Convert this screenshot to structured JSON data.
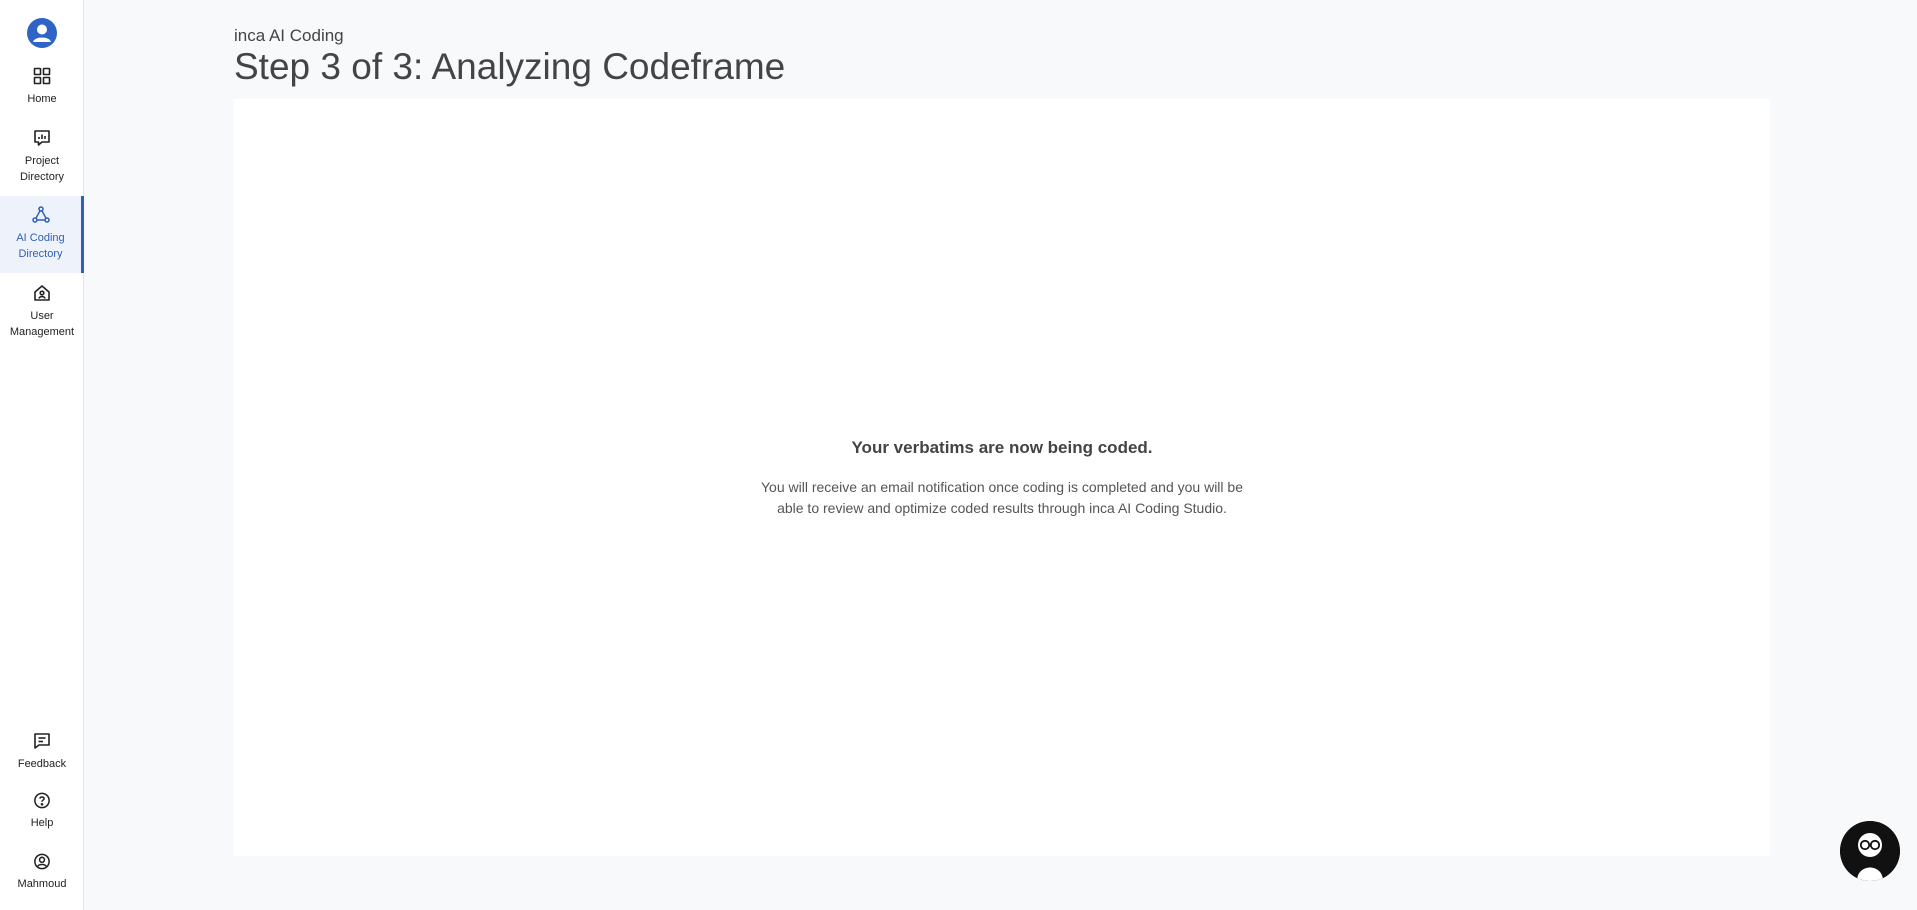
{
  "sidebar": {
    "items": [
      {
        "label": "Home"
      },
      {
        "label": "Project\nDirectory"
      },
      {
        "label": "AI Coding\nDirectory"
      },
      {
        "label": "User\nManagement"
      }
    ],
    "bottom": [
      {
        "label": "Feedback"
      },
      {
        "label": "Help"
      },
      {
        "label": "Mahmoud"
      }
    ]
  },
  "header": {
    "subtitle": "inca AI Coding",
    "title": "Step 3 of 3: Analyzing Codeframe"
  },
  "main": {
    "message_title": "Your verbatims are now being coded.",
    "message_body": "You will receive an email notification once coding is completed and you will be able to review and optimize coded results through inca AI Coding Studio."
  },
  "colors": {
    "accent": "#2f5fb8",
    "active_bg": "#eef2fb",
    "page_bg": "#f8f9fb"
  },
  "icons": {
    "brand": "user-avatar-icon",
    "home": "grid-icon",
    "project": "chart-board-icon",
    "ai": "network-icon",
    "user": "house-user-icon",
    "feedback": "chat-icon",
    "help": "question-icon",
    "profile": "user-circle-icon",
    "assistant": "assistant-avatar-icon"
  }
}
